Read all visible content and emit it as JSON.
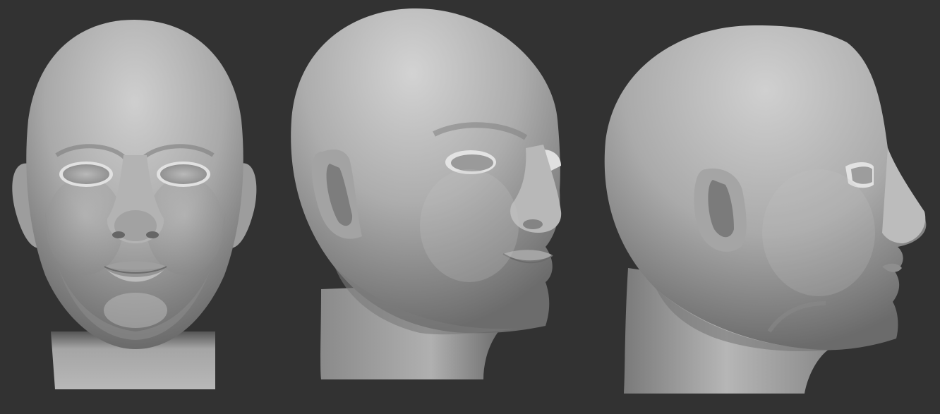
{
  "scene": {
    "background_color": "#323232",
    "material_color": "#9a9a9a",
    "views": [
      {
        "id": "front",
        "icon": "head-front-sculpt"
      },
      {
        "id": "three-quarter",
        "icon": "head-three-quarter-sculpt"
      },
      {
        "id": "profile",
        "icon": "head-profile-sculpt"
      }
    ]
  }
}
